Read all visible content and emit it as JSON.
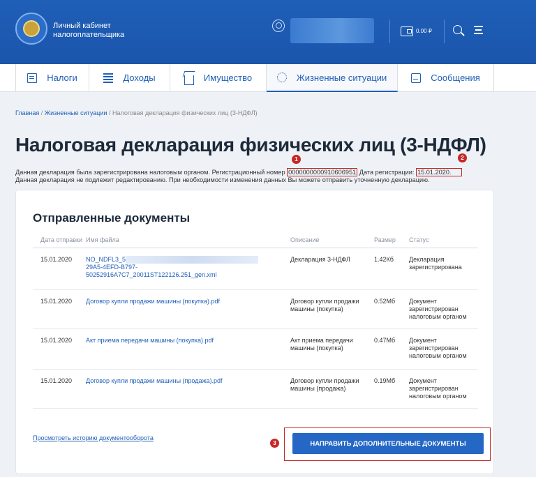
{
  "header": {
    "brand_line1": "Личный кабинет",
    "brand_line2": "налогоплательщика",
    "balance": "0.00 ₽"
  },
  "nav": {
    "tabs": [
      {
        "label": "Налоги",
        "icon": "document-icon"
      },
      {
        "label": "Доходы",
        "icon": "money-icon"
      },
      {
        "label": "Имущество",
        "icon": "house-icon"
      },
      {
        "label": "Жизненные ситуации",
        "icon": "life-situations-icon",
        "active": true
      },
      {
        "label": "Сообщения",
        "icon": "mail-icon"
      }
    ]
  },
  "breadcrumb": {
    "home": "Главная",
    "sep1": " / ",
    "section": "Жизненные ситуации",
    "sep2": " / ",
    "current": "Налоговая декларация физических лиц (3-НДФЛ)"
  },
  "page": {
    "title": "Налоговая декларация физических лиц (3-НДФЛ)",
    "info_prefix": "Данная декларация была зарегистрирована налоговым органом. Регистрационный номер ",
    "reg_number": "0000000000910606951",
    "info_mid": " Дата регистрации: ",
    "reg_date": "15.01.2020.",
    "info_line2": "Данная декларация не подлежит редактированию. При необходимости изменения данных Вы можете отправить уточненную декларацию."
  },
  "markers": [
    "1",
    "2",
    "3"
  ],
  "documents": {
    "title": "Отправленные документы",
    "headers": {
      "date": "Дата отправки",
      "filename": "Имя файла",
      "description": "Описание",
      "size": "Размер",
      "status": "Статус"
    },
    "rows": [
      {
        "date": "15.01.2020",
        "filename_l1": "NO_NDFL3_5",
        "filename_l2": "29A5-4EFD-B797-",
        "filename_l3": "50252916A7C7_20011ST122126.251_gen.xml",
        "description": "Декларация 3-НДФЛ",
        "size": "1.42Кб",
        "status": "Декларация зарегистрирована"
      },
      {
        "date": "15.01.2020",
        "filename": "Договор купли продажи машины (покупка).pdf",
        "description": "Договор купли продажи машины (покупка)",
        "size": "0.52Мб",
        "status": "Документ зарегистрирован налоговым органом"
      },
      {
        "date": "15.01.2020",
        "filename": "Акт приема передачи машины (покупка).pdf",
        "description": "Акт приема передачи машины (покупка)",
        "size": "0.47Мб",
        "status": "Документ зарегистрирован налоговым органом"
      },
      {
        "date": "15.01.2020",
        "filename": "Договор купли продажи машины (продажа).pdf",
        "description": "Договор купли продажи машины (продажа)",
        "size": "0.19Мб",
        "status": "Документ зарегистрирован налоговым органом"
      }
    ],
    "history_link": "Просмотреть историю документооборота",
    "send_button": "НАПРАВИТЬ ДОПОЛНИТЕЛЬНЫЕ ДОКУМЕНТЫ"
  },
  "colors": {
    "brand": "#1f5fb8",
    "highlight": "#c62828"
  }
}
